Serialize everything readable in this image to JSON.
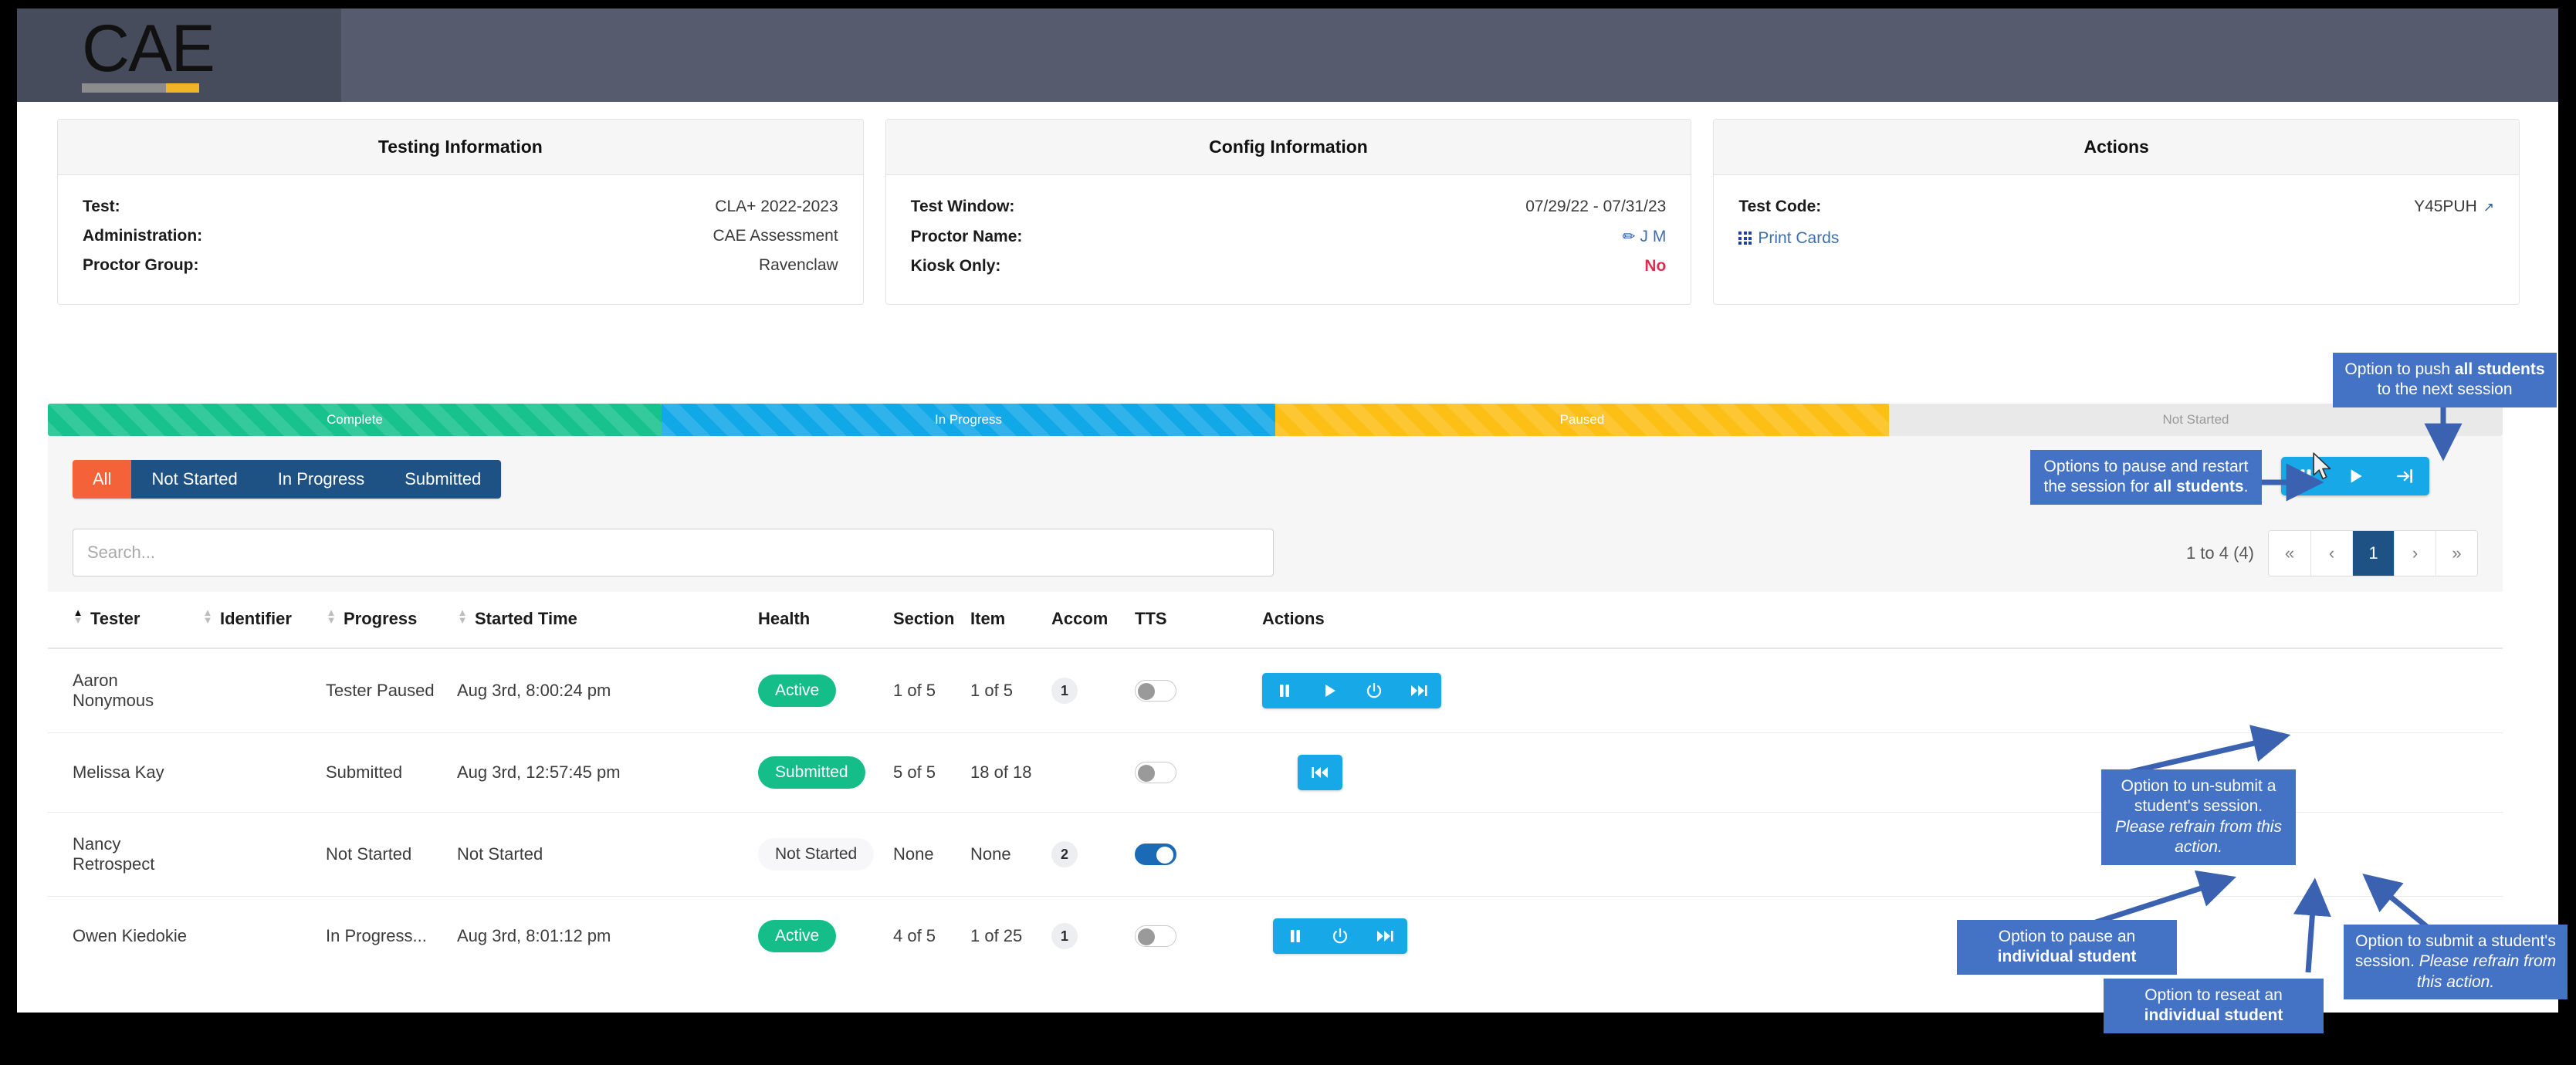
{
  "brand": {
    "logo_text": "CAE",
    "accent_gold": "#f0b429",
    "header_bg": "#565c6e",
    "logo_panel_bg": "#474c5c"
  },
  "cards": [
    {
      "title": "Testing Information",
      "rows": [
        {
          "label": "Test:",
          "value": "CLA+ 2022-2023"
        },
        {
          "label": "Administration:",
          "value": "CAE Assessment"
        },
        {
          "label": "Proctor Group:",
          "value": "Ravenclaw"
        }
      ]
    },
    {
      "title": "Config Information",
      "rows": [
        {
          "label": "Test Window:",
          "value": "07/29/22 - 07/31/23"
        },
        {
          "label": "Proctor Name:",
          "value": "J M"
        },
        {
          "label": "Kiosk Only:",
          "value": "No"
        }
      ]
    },
    {
      "title": "Actions",
      "rows": [
        {
          "label": "Test Code:",
          "value": "Y45PUH"
        }
      ],
      "print_cards_label": "Print Cards"
    }
  ],
  "progress_bar": {
    "segments": [
      {
        "label": "Complete",
        "color": "#17c28c",
        "pct": 25
      },
      {
        "label": "In Progress",
        "color": "#11a8e8",
        "pct": 25
      },
      {
        "label": "Paused",
        "color": "#fcbf15",
        "pct": 25
      },
      {
        "label": "Not Started",
        "color": "#e9e9e9",
        "pct": 25
      }
    ]
  },
  "filters": {
    "items": [
      {
        "label": "All",
        "active": true
      },
      {
        "label": "Not Started",
        "active": false
      },
      {
        "label": "In Progress",
        "active": false
      },
      {
        "label": "Submitted",
        "active": false
      }
    ]
  },
  "session_actions": {
    "buttons": [
      "pause-icon",
      "play-icon",
      "push-next-icon"
    ]
  },
  "search": {
    "placeholder": "Search...",
    "value": ""
  },
  "pagination": {
    "count_text": "1 to 4 (4)",
    "first": "«",
    "prev": "‹",
    "current": "1",
    "next": "›",
    "last": "»"
  },
  "table": {
    "headers": [
      {
        "label": "Tester",
        "sortable": true,
        "sorted": "asc"
      },
      {
        "label": "Identifier",
        "sortable": true,
        "sorted": "none"
      },
      {
        "label": "Progress",
        "sortable": true,
        "sorted": "none"
      },
      {
        "label": "Started Time",
        "sortable": true,
        "sorted": "none"
      },
      {
        "label": "Health",
        "sortable": false,
        "sorted": "none"
      },
      {
        "label": "Section",
        "sortable": false,
        "sorted": "none"
      },
      {
        "label": "Item",
        "sortable": false,
        "sorted": "none"
      },
      {
        "label": "Accom",
        "sortable": false,
        "sorted": "none"
      },
      {
        "label": "TTS",
        "sortable": false,
        "sorted": "none"
      },
      {
        "label": "Actions",
        "sortable": false,
        "sorted": "none"
      }
    ],
    "rows": [
      {
        "tester": "Aaron Nonymous",
        "identifier": "",
        "progress": "Tester Paused",
        "progress_style": "paused",
        "started_time": "Aug 3rd, 8:00:24 pm",
        "health": "Active",
        "health_style": "green",
        "section": "1 of 5",
        "item": "1 of 5",
        "accom": "1",
        "tts_on": false,
        "actions": [
          "pause-icon",
          "play-icon",
          "power-icon",
          "fast-forward-icon"
        ]
      },
      {
        "tester": "Melissa Kay",
        "identifier": "",
        "progress": "Submitted",
        "progress_style": "submitted",
        "started_time": "Aug 3rd, 12:57:45 pm",
        "health": "Submitted",
        "health_style": "green",
        "section": "5 of 5",
        "item": "18 of 18",
        "accom": "",
        "tts_on": false,
        "actions": [
          "rewind-icon"
        ]
      },
      {
        "tester": "Nancy Retrospect",
        "identifier": "",
        "progress": "Not Started",
        "progress_style": "none",
        "started_time": "Not Started",
        "health": "Not Started",
        "health_style": "none",
        "section": "None",
        "item": "None",
        "accom": "2",
        "tts_on": true,
        "actions": []
      },
      {
        "tester": "Owen Kiedokie",
        "identifier": "",
        "progress": "In Progress...",
        "progress_style": "inprogress",
        "started_time": "Aug 3rd, 8:01:12 pm",
        "health": "Active",
        "health_style": "green",
        "section": "4 of 5",
        "item": "1 of 25",
        "accom": "1",
        "tts_on": false,
        "actions": [
          "pause-icon",
          "power-icon",
          "fast-forward-icon"
        ]
      }
    ]
  },
  "annotations": {
    "push_all": {
      "part1": "Option to push ",
      "bold": "all students",
      "part2": " to the next session"
    },
    "pause_restart_all": {
      "part1": "Options to pause and restart the session for ",
      "bold": "all students",
      "part2": "."
    },
    "unsubmit": {
      "part1": "Option to un-submit a student's session. ",
      "italic": "Please refrain from this action."
    },
    "pause_individual": {
      "part1": "Option to pause an ",
      "bold": "individual student"
    },
    "reseat_individual": {
      "part1": "Option to reseat an ",
      "bold": "individual student"
    },
    "submit_individual": {
      "part1": "Option to submit a student's session. ",
      "italic": "Please refrain from this action."
    }
  }
}
